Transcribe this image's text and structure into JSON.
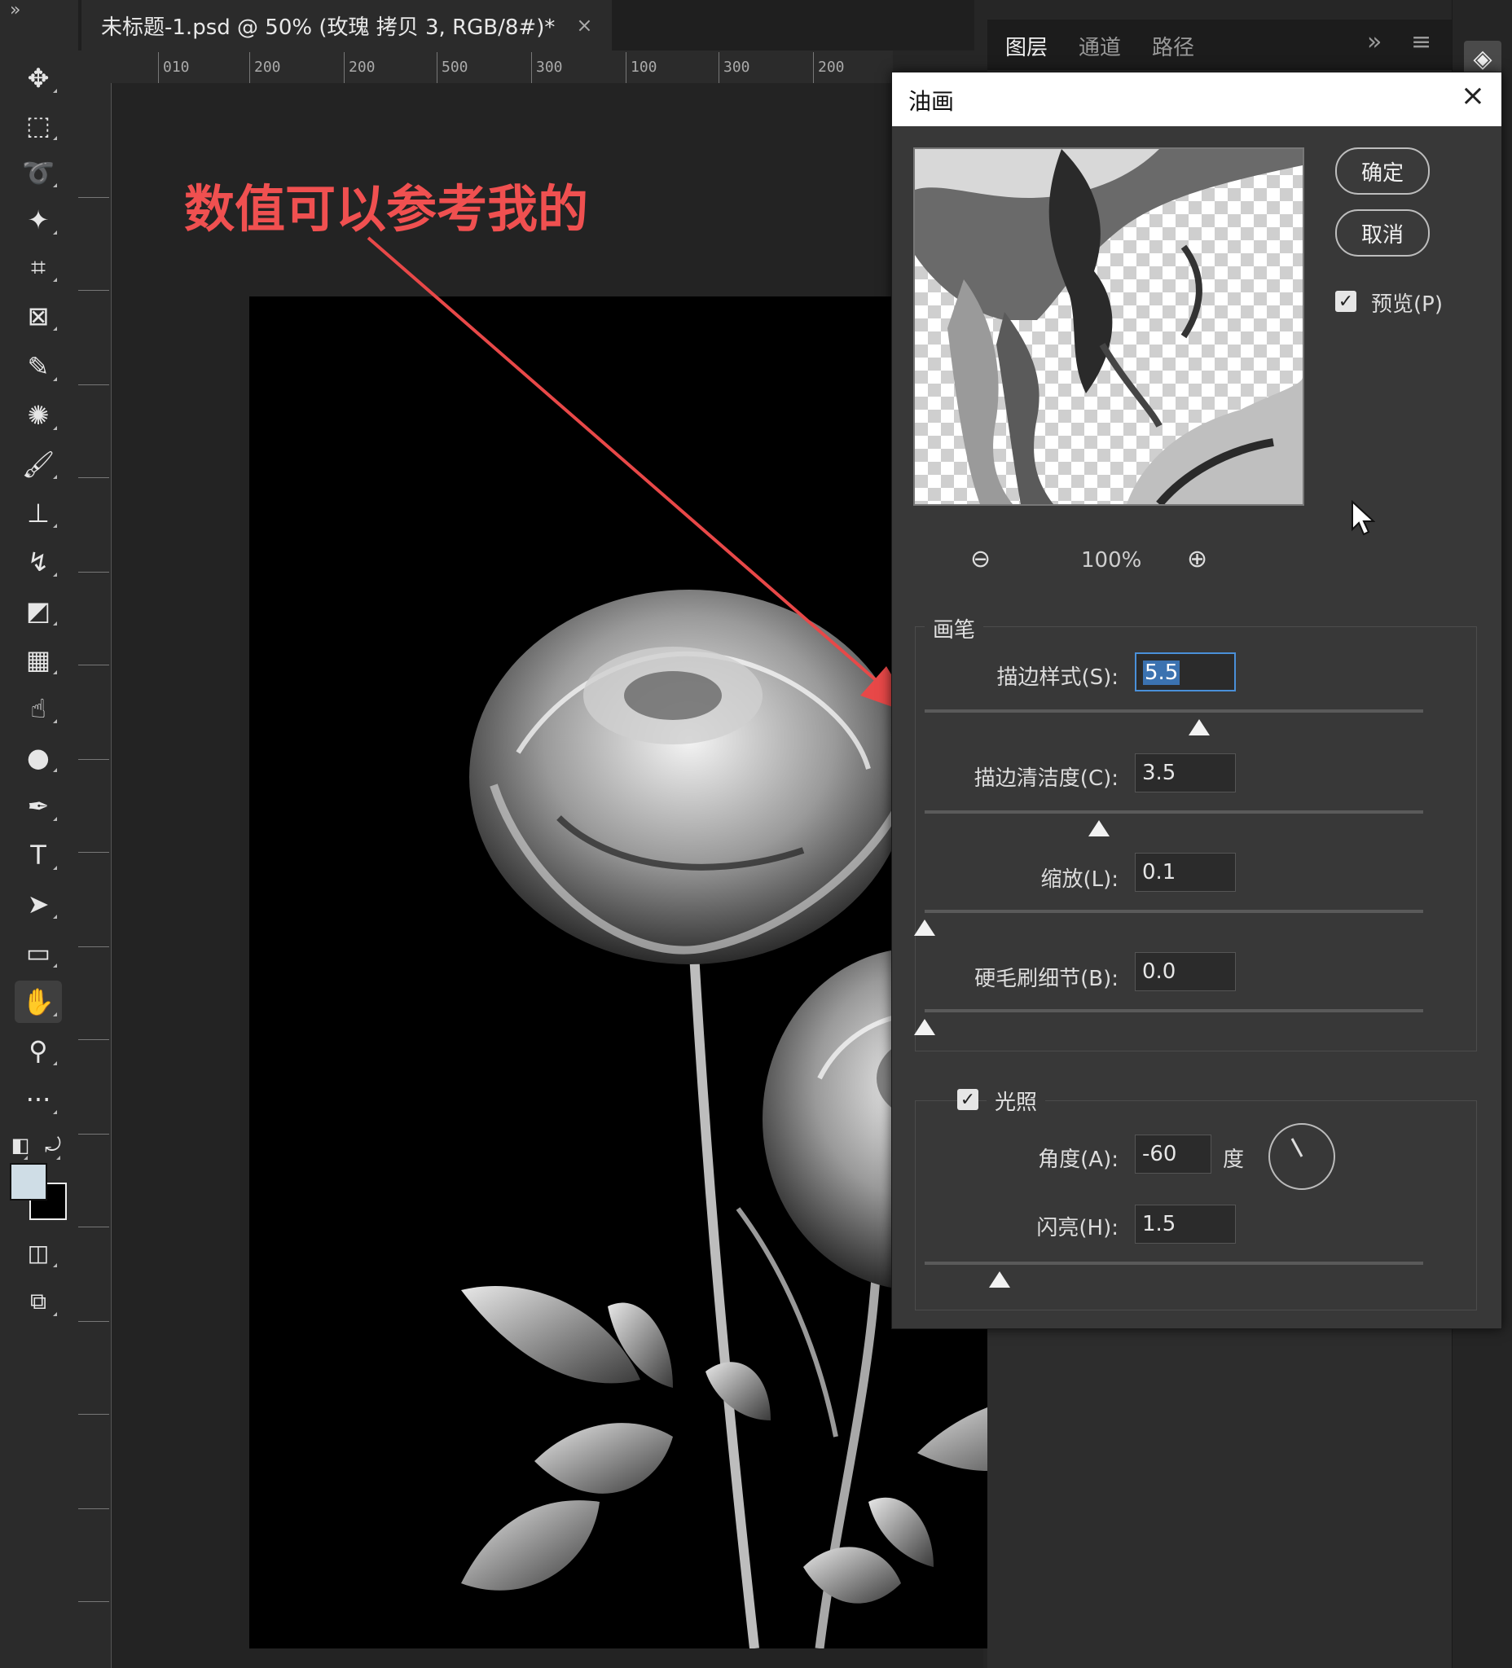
{
  "document_tab": {
    "title": "未标题-1.psd @ 50% (玫瑰 拷贝 3, RGB/8#)*",
    "close": "×"
  },
  "ruler_labels": [
    "010",
    "200",
    "200",
    "500",
    "300",
    "100",
    "300",
    "200"
  ],
  "panel_tabs": [
    "图层",
    "通道",
    "路径"
  ],
  "panel_controls": {
    "expand": "»",
    "menu": "≡"
  },
  "annotation": {
    "text": "数值可以参考我的",
    "color": "#f05050"
  },
  "dialog": {
    "title": "油画",
    "close": "×",
    "ok": "确定",
    "cancel": "取消",
    "preview_label": "预览(P)",
    "preview_checked": true,
    "zoom_out": "−",
    "zoom_in": "+",
    "zoom_level": "100%",
    "brush_group": {
      "title": "画笔",
      "stylization": {
        "label": "描边样式(S):",
        "value": "5.5",
        "fraction": 0.55
      },
      "cleanliness": {
        "label": "描边清洁度(C):",
        "value": "3.5",
        "fraction": 0.35
      },
      "scale": {
        "label": "缩放(L):",
        "value": "0.1",
        "fraction": 0.0
      },
      "bristle": {
        "label": "硬毛刷细节(B):",
        "value": "0.0",
        "fraction": 0.0
      }
    },
    "lighting_group": {
      "title": "光照",
      "checked": true,
      "angle": {
        "label": "角度(A):",
        "value": "-60",
        "unit": "度"
      },
      "shine": {
        "label": "闪亮(H):",
        "value": "1.5",
        "fraction": 0.15
      }
    }
  },
  "colors": {
    "accent": "#4a90d9",
    "arrow": "#e84848",
    "foreground_swatch": "#cfdde6"
  },
  "tools": [
    "move-icon",
    "marquee-icon",
    "lasso-icon",
    "magic-wand-icon",
    "crop-icon",
    "frame-icon",
    "eyedropper-icon",
    "healing-icon",
    "brush-icon",
    "stamp-icon",
    "history-brush-icon",
    "eraser-icon",
    "gradient-icon",
    "smudge-icon",
    "dodge-icon",
    "pen-icon",
    "type-icon",
    "path-select-icon",
    "rectangle-icon",
    "hand-icon",
    "zoom-icon",
    "more-icon"
  ]
}
